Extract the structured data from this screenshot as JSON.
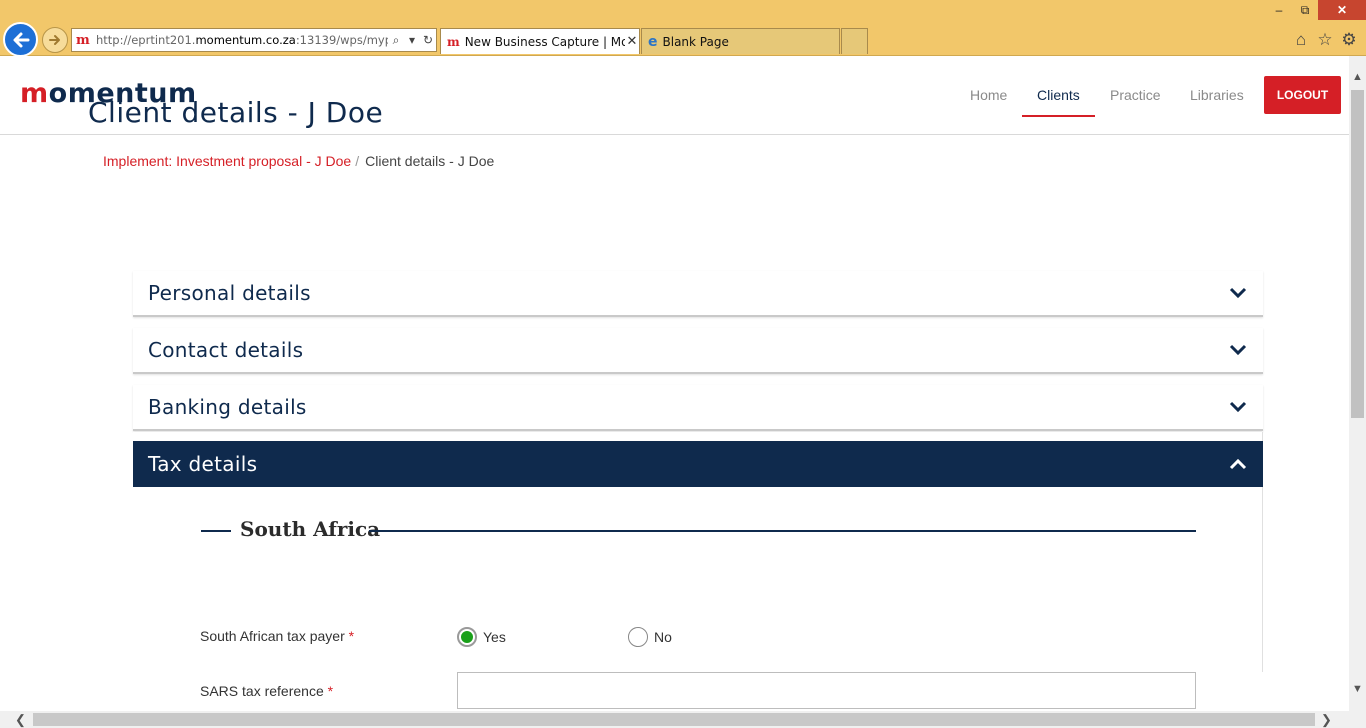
{
  "browser": {
    "address": {
      "url_prefix": "http://eprtint201.",
      "url_domain": "momentum.co.za",
      "url_suffix": ":13139/wps/mypor"
    },
    "tabs": [
      {
        "title": "New Business Capture | Mo...",
        "active": true
      },
      {
        "title": "Blank Page",
        "active": false
      }
    ],
    "window_controls": {
      "minimize": "–",
      "restore": "⧉",
      "close": "✕"
    },
    "tools": {
      "home": "⌂",
      "favorites": "☆",
      "settings": "⚙"
    }
  },
  "site": {
    "logo_first": "m",
    "logo_rest": "omentum",
    "nav": {
      "home": "Home",
      "clients": "Clients",
      "practice": "Practice",
      "libraries": "Libraries"
    },
    "logout": "LOGOUT",
    "accent": "#d51f26",
    "navy": "#0f2a4d"
  },
  "page": {
    "title": "Client details - J Doe",
    "breadcrumb": {
      "link": "Implement: Investment proposal - J Doe",
      "separator": "/",
      "current": "Client details - J Doe"
    }
  },
  "accordion": [
    {
      "label": "Personal details",
      "expanded": false
    },
    {
      "label": "Contact details",
      "expanded": false
    },
    {
      "label": "Banking details",
      "expanded": false
    },
    {
      "label": "Tax details",
      "expanded": true
    }
  ],
  "tax": {
    "section_title": "South Africa",
    "taxpayer": {
      "label": "South African tax payer",
      "required_mark": "*",
      "options": [
        "Yes",
        "No"
      ],
      "selected": "Yes"
    },
    "sars_ref": {
      "label": "SARS tax reference",
      "required_mark": "*",
      "value": ""
    }
  }
}
